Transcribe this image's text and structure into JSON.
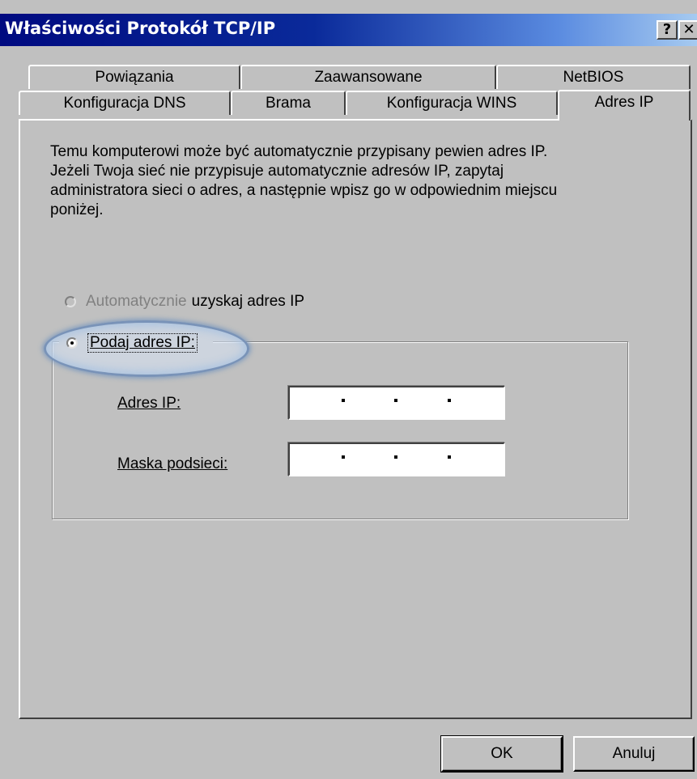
{
  "window": {
    "title": "Właściwości Protokół TCP/IP",
    "help_label": "?",
    "close_label": "✕"
  },
  "tabs_back": [
    "Powiązania",
    "Zaawansowane",
    "NetBIOS"
  ],
  "tabs_front": [
    "Konfiguracja DNS",
    "Brama",
    "Konfiguracja WINS",
    "Adres IP"
  ],
  "selected_tab": "Adres IP",
  "description": "Temu komputerowi może być automatycznie przypisany pewien adres IP. Jeżeli Twoja sieć nie przypisuje automatycznie adresów IP, zapytaj administratora sieci o adres, a następnie wpisz go w odpowiednim miejscu poniżej.",
  "options": {
    "auto_label_part1": "Automatycznie",
    "auto_label_part2": "uzyskaj adres IP",
    "manual_label": "Podaj adres IP:",
    "selected": "manual"
  },
  "fields": {
    "ip_label": "Adres IP:",
    "ip_value": ". . .",
    "mask_label": "Maska podsieci:",
    "mask_value": ". . ."
  },
  "buttons": {
    "ok": "OK",
    "cancel": "Anuluj"
  }
}
